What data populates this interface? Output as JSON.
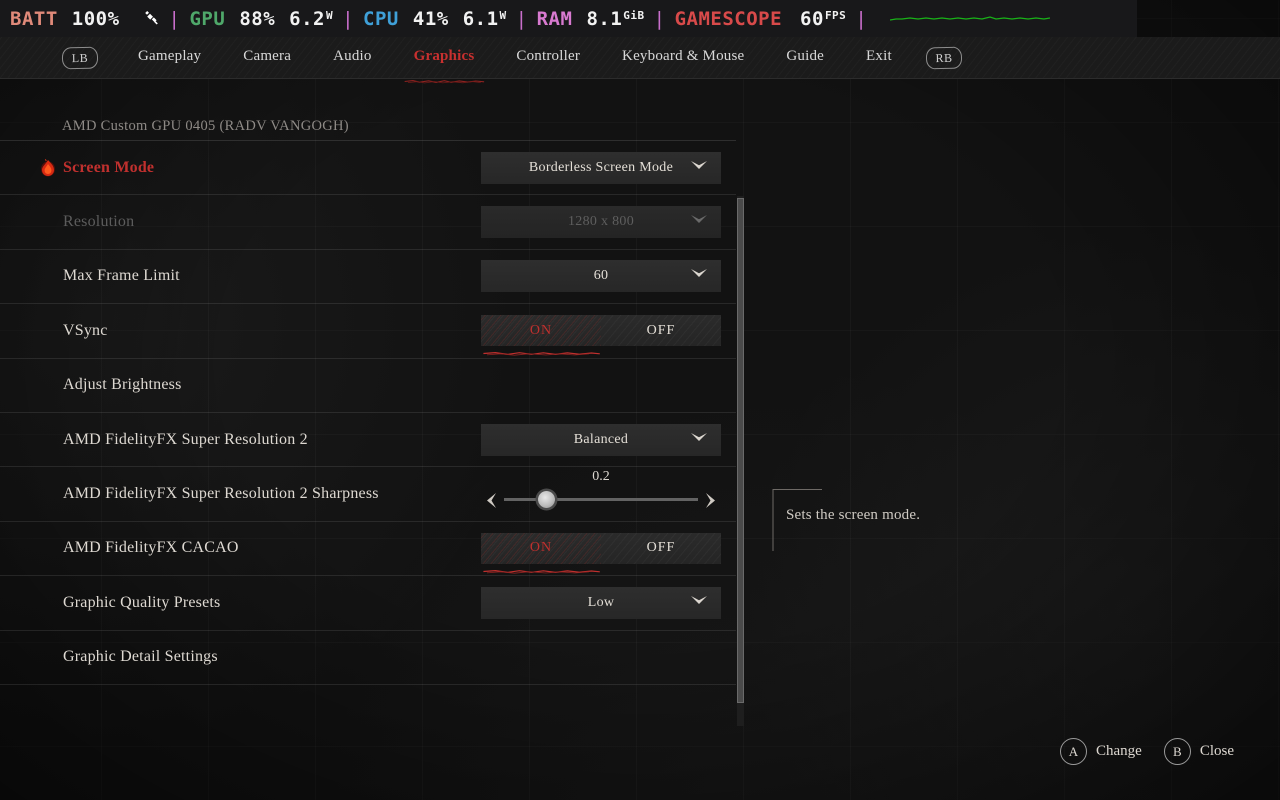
{
  "perf_overlay": {
    "battery_label": "BATT",
    "battery_value": "100%",
    "plug_icon": "power-plug-icon",
    "gpu_label": "GPU",
    "gpu_usage": "88%",
    "gpu_power": "6.2",
    "gpu_power_unit": "W",
    "cpu_label": "CPU",
    "cpu_usage": "41%",
    "cpu_power": "6.1",
    "cpu_power_unit": "W",
    "ram_label": "RAM",
    "ram_value": "8.1",
    "ram_unit": "GiB",
    "gamescope_label": "GAMESCOPE",
    "fps_value": "60",
    "fps_unit": "FPS",
    "separator": "|",
    "colors": {
      "battery": "#e08a7a",
      "gpu": "#4fa86a",
      "cpu": "#3fa0d8",
      "ram": "#d87ad0",
      "gamescope": "#d84a4a",
      "value": "#f2f2f2",
      "separator": "#c86ecb",
      "graph": "#18b218"
    }
  },
  "nav": {
    "left_bumper": "LB",
    "right_bumper": "RB",
    "tabs": [
      {
        "label": "Gameplay",
        "active": false
      },
      {
        "label": "Camera",
        "active": false
      },
      {
        "label": "Audio",
        "active": false
      },
      {
        "label": "Graphics",
        "active": true
      },
      {
        "label": "Controller",
        "active": false
      },
      {
        "label": "Keyboard & Mouse",
        "active": false
      },
      {
        "label": "Guide",
        "active": false
      },
      {
        "label": "Exit",
        "active": false
      }
    ],
    "active_color": "#c8302f"
  },
  "settings": {
    "gpu_info": "AMD Custom GPU 0405 (RADV VANGOGH)",
    "rows": [
      {
        "label": "Screen Mode",
        "control": "dropdown",
        "value": "Borderless Screen Mode",
        "selected": true,
        "disabled": false
      },
      {
        "label": "Resolution",
        "control": "dropdown",
        "value": "1280 x 800",
        "selected": false,
        "disabled": true
      },
      {
        "label": "Max Frame Limit",
        "control": "dropdown",
        "value": "60",
        "selected": false,
        "disabled": false
      },
      {
        "label": "VSync",
        "control": "toggle",
        "on_label": "ON",
        "off_label": "OFF",
        "value": "ON",
        "selected": false,
        "disabled": false
      },
      {
        "label": "Adjust Brightness",
        "control": "none",
        "selected": false,
        "disabled": false
      },
      {
        "label": "AMD FidelityFX Super Resolution 2",
        "control": "dropdown",
        "value": "Balanced",
        "selected": false,
        "disabled": false
      },
      {
        "label": "AMD FidelityFX Super Resolution 2 Sharpness",
        "control": "slider",
        "value": "0.2",
        "fraction": 0.22,
        "left_arrow": "◀",
        "right_arrow": "▶",
        "selected": false,
        "disabled": false
      },
      {
        "label": "AMD FidelityFX CACAO",
        "control": "toggle",
        "on_label": "ON",
        "off_label": "OFF",
        "value": "ON",
        "selected": false,
        "disabled": false
      },
      {
        "label": "Graphic Quality Presets",
        "control": "dropdown",
        "value": "Low",
        "selected": false,
        "disabled": false
      },
      {
        "label": "Graphic Detail Settings",
        "control": "none",
        "selected": false,
        "disabled": false
      }
    ]
  },
  "description": {
    "text": "Sets the screen mode."
  },
  "footer_hints": [
    {
      "glyph": "A",
      "label": "Change"
    },
    {
      "glyph": "B",
      "label": "Close"
    }
  ]
}
